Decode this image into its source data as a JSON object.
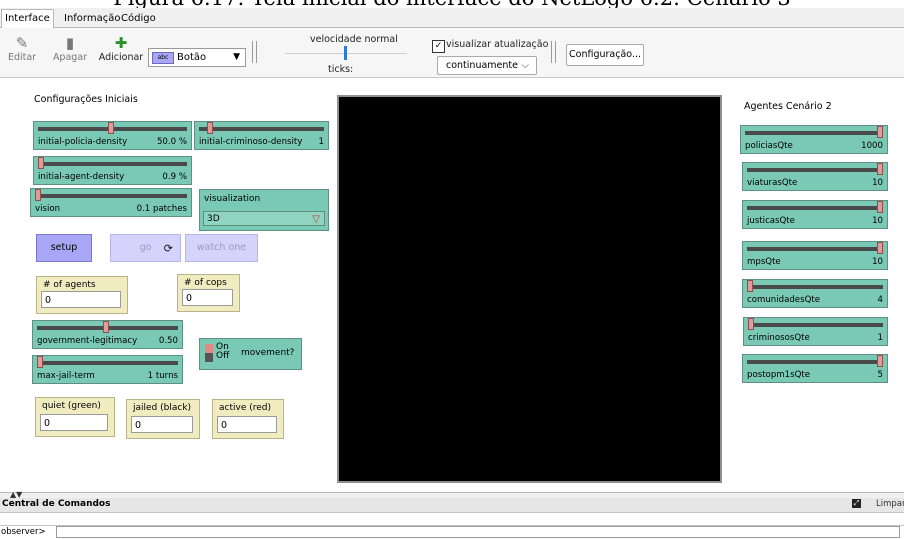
{
  "caption": "Figura 6.17: Tela inicial do interface do NetLogo 6.2: Cenário 3",
  "tabs": [
    "Interface",
    "Informação",
    "Código"
  ],
  "toolbar": {
    "edit": "Editar",
    "delete": "Apagar",
    "add": "Adicionar",
    "widget_type": "Botão",
    "speed_label": "velocidade normal",
    "ticks_label": "ticks:",
    "view_updates_label": "visualizar atualização",
    "view_updates_checked": true,
    "update_mode": "continuamente",
    "settings": "Configuração..."
  },
  "interface": {
    "initial_settings_note": "Configurações Iniciais",
    "agents_note": "Agentes Cenário 2",
    "sliders": [
      {
        "label": "initial-policia-density",
        "value": "50.0 %",
        "fraction": 0.5
      },
      {
        "label": "initial-criminoso-density",
        "value": "1",
        "fraction": 0.0
      },
      {
        "label": "initial-agent-density",
        "value": "0.9 %",
        "fraction": 0.0
      },
      {
        "label": "vision",
        "value": "0.1 patches",
        "fraction": 0.0
      },
      {
        "label": "government-legitimacy",
        "value": "0.50",
        "fraction": 0.5
      },
      {
        "label": "max-jail-term",
        "value": "1 turns",
        "fraction": 0.0
      }
    ],
    "chooser": {
      "label": "visualization",
      "value": "3D"
    },
    "buttons": {
      "setup": "setup",
      "go": "go",
      "watch": "watch one"
    },
    "switch": {
      "label": "movement?",
      "on": "On",
      "off": "Off"
    },
    "monitors": [
      {
        "label": "# of agents",
        "value": "0"
      },
      {
        "label": "# of cops",
        "value": "0"
      },
      {
        "label": "quiet (green)",
        "value": "0"
      },
      {
        "label": "jailed (black)",
        "value": "0"
      },
      {
        "label": "active (red)",
        "value": "0"
      }
    ],
    "agent_sliders": [
      {
        "label": "policiasQte",
        "value": "1000",
        "fraction": 1.0
      },
      {
        "label": "viaturasQte",
        "value": "10",
        "fraction": 1.0
      },
      {
        "label": "justicasQte",
        "value": "10",
        "fraction": 1.0
      },
      {
        "label": "mpsQte",
        "value": "10",
        "fraction": 1.0
      },
      {
        "label": "comunidadesQte",
        "value": "4",
        "fraction": 0.0
      },
      {
        "label": "criminososQte",
        "value": "1",
        "fraction": 0.0
      },
      {
        "label": "postopm1sQte",
        "value": "5",
        "fraction": 1.0
      }
    ]
  },
  "command_center": {
    "title": "Central de Comandos",
    "clear": "Limpar",
    "prompt": "observer>"
  }
}
